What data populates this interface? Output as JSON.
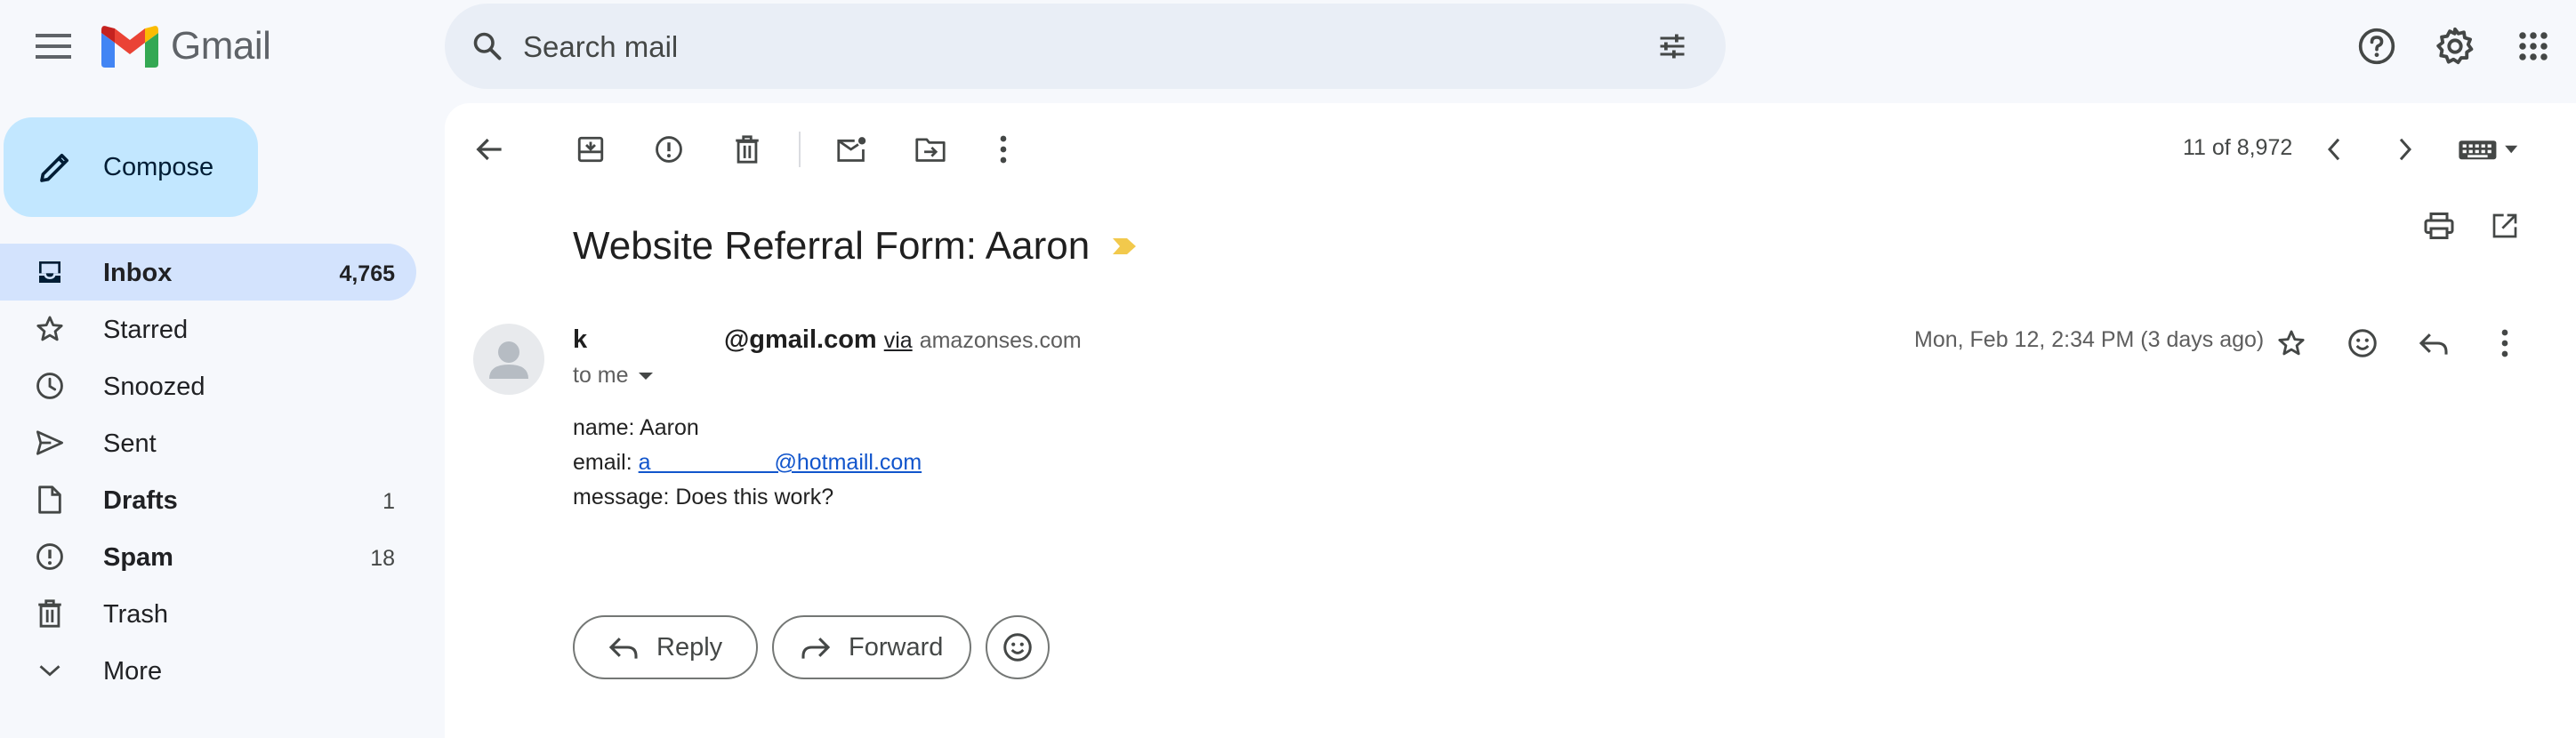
{
  "app": {
    "name": "Gmail"
  },
  "search": {
    "placeholder": "Search mail"
  },
  "compose": {
    "label": "Compose"
  },
  "nav": {
    "items": [
      {
        "label": "Inbox",
        "count": "4,765",
        "icon": "inbox-icon",
        "active": true,
        "bold": true
      },
      {
        "label": "Starred",
        "count": "",
        "icon": "star-icon",
        "active": false,
        "bold": false
      },
      {
        "label": "Snoozed",
        "count": "",
        "icon": "clock-icon",
        "active": false,
        "bold": false
      },
      {
        "label": "Sent",
        "count": "",
        "icon": "send-icon",
        "active": false,
        "bold": false
      },
      {
        "label": "Drafts",
        "count": "1",
        "icon": "draft-icon",
        "active": false,
        "bold": true
      },
      {
        "label": "Spam",
        "count": "18",
        "icon": "spam-icon",
        "active": false,
        "bold": true
      },
      {
        "label": "Trash",
        "count": "",
        "icon": "trash-icon",
        "active": false,
        "bold": false
      },
      {
        "label": "More",
        "count": "",
        "icon": "chevron-down-icon",
        "active": false,
        "bold": false
      }
    ]
  },
  "toolbar": {
    "pager": "11 of 8,972"
  },
  "message": {
    "subject": "Website Referral Form: Aaron",
    "sender_name": "k",
    "sender_email": "@gmail.com",
    "via_label": "via",
    "via_domain": "amazonses.com",
    "to_label": "to me",
    "date": "Mon, Feb 12, 2:34 PM (3 days ago)",
    "body": {
      "name_line": "name: Aaron",
      "email_prefix": "email: ",
      "email_link": "a                    @hotmaill.com",
      "message_line": "message: Does this work?"
    }
  },
  "actions": {
    "reply_label": "Reply",
    "forward_label": "Forward"
  },
  "colors": {
    "background": "#f6f8fc",
    "search_bg": "#e9eef6",
    "compose_bg": "#c2e7ff",
    "nav_active_bg": "#d3e3fd",
    "importance_marker": "#f2c94c",
    "link": "#1155cc"
  }
}
